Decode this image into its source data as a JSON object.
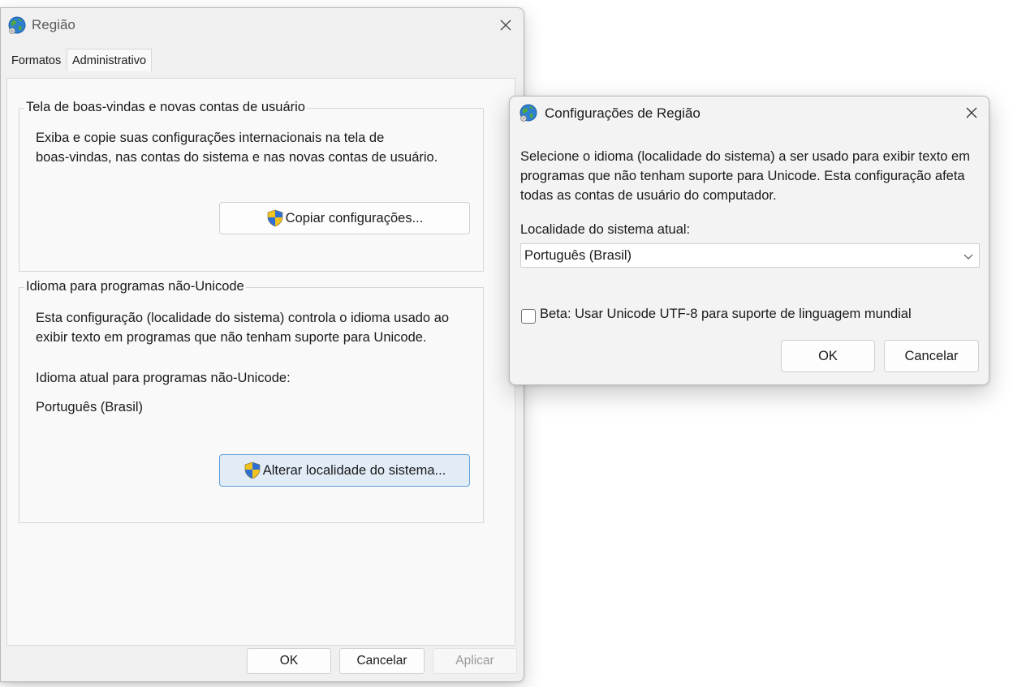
{
  "region_window": {
    "title": "Região",
    "tabs": [
      {
        "label": "Formatos",
        "selected": false
      },
      {
        "label": "Administrativo",
        "selected": true
      }
    ],
    "welcome_group": {
      "legend": "Tela de boas-vindas e novas contas de usuário",
      "description_line1": "Exiba e copie suas configurações internacionais na tela de",
      "description_line2": "boas-vindas, nas contas do sistema e nas novas contas de usuário.",
      "copy_button_label": "Copiar configurações..."
    },
    "unicode_group": {
      "legend": "Idioma para programas não-Unicode",
      "description_line1": "Esta configuração (localidade do sistema) controla o idioma usado ao",
      "description_line2": "exibir texto em programas que não tenham suporte para Unicode.",
      "current_label": "Idioma atual para programas não-Unicode:",
      "current_value": "Português (Brasil)",
      "change_button_label": "Alterar localidade do sistema..."
    },
    "footer": {
      "ok_label": "OK",
      "cancel_label": "Cancelar",
      "apply_label": "Aplicar",
      "apply_enabled": false
    }
  },
  "config_dialog": {
    "title": "Configurações de Região",
    "description_line1": "Selecione o idioma (localidade do sistema) a ser usado para exibir texto em",
    "description_line2": "programas que não tenham suporte para Unicode. Esta configuração afeta",
    "description_line3": "todas as contas de usuário do computador.",
    "current_locale_label": "Localidade do sistema atual:",
    "current_locale_value": "Português (Brasil)",
    "beta_checkbox_label": "Beta: Usar Unicode UTF-8 para suporte de linguagem mundial",
    "beta_checked": false,
    "ok_label": "OK",
    "cancel_label": "Cancelar"
  },
  "icons": {
    "app_icon": "globe-icon",
    "close_icon": "close-icon",
    "uac_icon": "uac-shield-icon",
    "dropdown_icon": "chevron-down-icon"
  },
  "colors": {
    "window_bg": "#f0f0f0",
    "panel_bg": "#f9f9f9",
    "focus_button_bg": "#e1ecf7",
    "focus_button_border": "#5f9fd6",
    "disabled_text": "#9a9a9a"
  }
}
